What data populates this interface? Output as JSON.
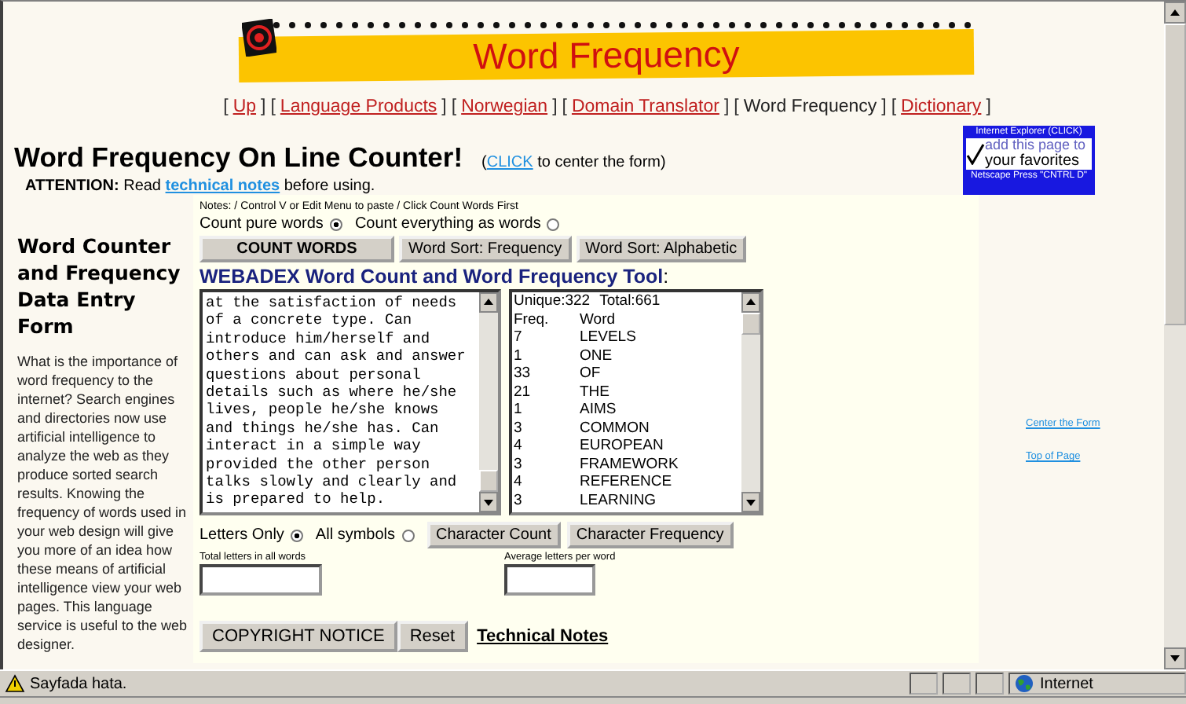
{
  "banner": {
    "title": "Word Frequency"
  },
  "nav": [
    {
      "open": "[",
      "label": "Up",
      "close": "]",
      "kind": "link"
    },
    {
      "open": "[",
      "label": "Language Products",
      "close": "]",
      "kind": "link"
    },
    {
      "open": "[",
      "label": "Norwegian",
      "close": "]",
      "kind": "link"
    },
    {
      "open": "[",
      "label": "Domain Translator",
      "close": "]",
      "kind": "link"
    },
    {
      "open": "[",
      "label": "Word Frequency",
      "close": "]",
      "kind": "current"
    },
    {
      "open": "[",
      "label": "Dictionary",
      "close": "]",
      "kind": "link"
    }
  ],
  "heading": {
    "title": "Word Frequency On Line Counter!",
    "open": "(",
    "link": "CLICK",
    "rest": "to center the form)"
  },
  "attention": {
    "label": "ATTENTION:",
    "before": "Read",
    "link": "technical notes",
    "after": "before using."
  },
  "favorites_ad": {
    "top": "Internet Explorer (CLICK)",
    "line1": "add this page to",
    "line2": "your favorites",
    "bottom": "Netscape Press \"CNTRL D\""
  },
  "sidebar": {
    "title": "Word Counter and  Frequency Data Entry Form",
    "text": "What is the importance of word frequency to the internet?  Search engines and directories now use artificial intelligence to analyze the web as they produce sorted search results.  Knowing the frequency of words used in your web design will give you more of an idea how these means of artificial intelligence view your web pages.  This language service is useful to the web designer."
  },
  "form": {
    "notes": "Notes: / Control V or Edit Menu to paste / Click Count Words First",
    "count_modes": [
      {
        "label": "Count pure words",
        "selected": true
      },
      {
        "label": "Count everything as words",
        "selected": false
      }
    ],
    "buttons": [
      {
        "label": "COUNT WORDS",
        "kind": "wide"
      },
      {
        "label": "Word Sort: Frequency",
        "kind": "normal"
      },
      {
        "label": "Word Sort: Alphabetic",
        "kind": "normal"
      }
    ],
    "tool_title": "WEBADEX Word Count and Word Frequency Tool",
    "tool_colon": ":",
    "text_lines": [
      "at the satisfaction of needs",
      "of a concrete type. Can",
      "introduce him/herself and",
      "others and can ask and answer",
      "questions about personal",
      "details such as where he/she",
      "lives, people he/she knows",
      "and things he/she has. Can",
      "interact in a simple way",
      "provided the other person",
      "talks slowly and clearly and",
      "is prepared to help."
    ],
    "summary": {
      "unique": "Unique:322",
      "total": "Total:661"
    },
    "freq_header": {
      "freq": "Freq.",
      "word": "Word"
    },
    "freq_rows": [
      {
        "freq": "7",
        "word": "LEVELS"
      },
      {
        "freq": "1",
        "word": "ONE"
      },
      {
        "freq": "33",
        "word": "OF"
      },
      {
        "freq": "21",
        "word": "THE"
      },
      {
        "freq": "1",
        "word": "AIMS"
      },
      {
        "freq": "3",
        "word": "COMMON"
      },
      {
        "freq": "4",
        "word": "EUROPEAN"
      },
      {
        "freq": "3",
        "word": "FRAMEWORK"
      },
      {
        "freq": "4",
        "word": "REFERENCE"
      },
      {
        "freq": "3",
        "word": "LEARNING"
      }
    ],
    "symbol_modes": [
      {
        "label": "Letters Only",
        "selected": true
      },
      {
        "label": "All symbols",
        "selected": false
      }
    ],
    "char_buttons": [
      "Character Count",
      "Character Frequency"
    ],
    "total_letters_label": "Total  letters in all words",
    "average_label": "Average letters per word",
    "bottom_buttons": [
      "COPYRIGHT NOTICE",
      "Reset"
    ],
    "tech_link": "Technical Notes"
  },
  "side_links": [
    "Center the Form",
    "Top of Page"
  ],
  "status_bar": {
    "message": "Sayfada hata.",
    "zone": "Internet"
  }
}
